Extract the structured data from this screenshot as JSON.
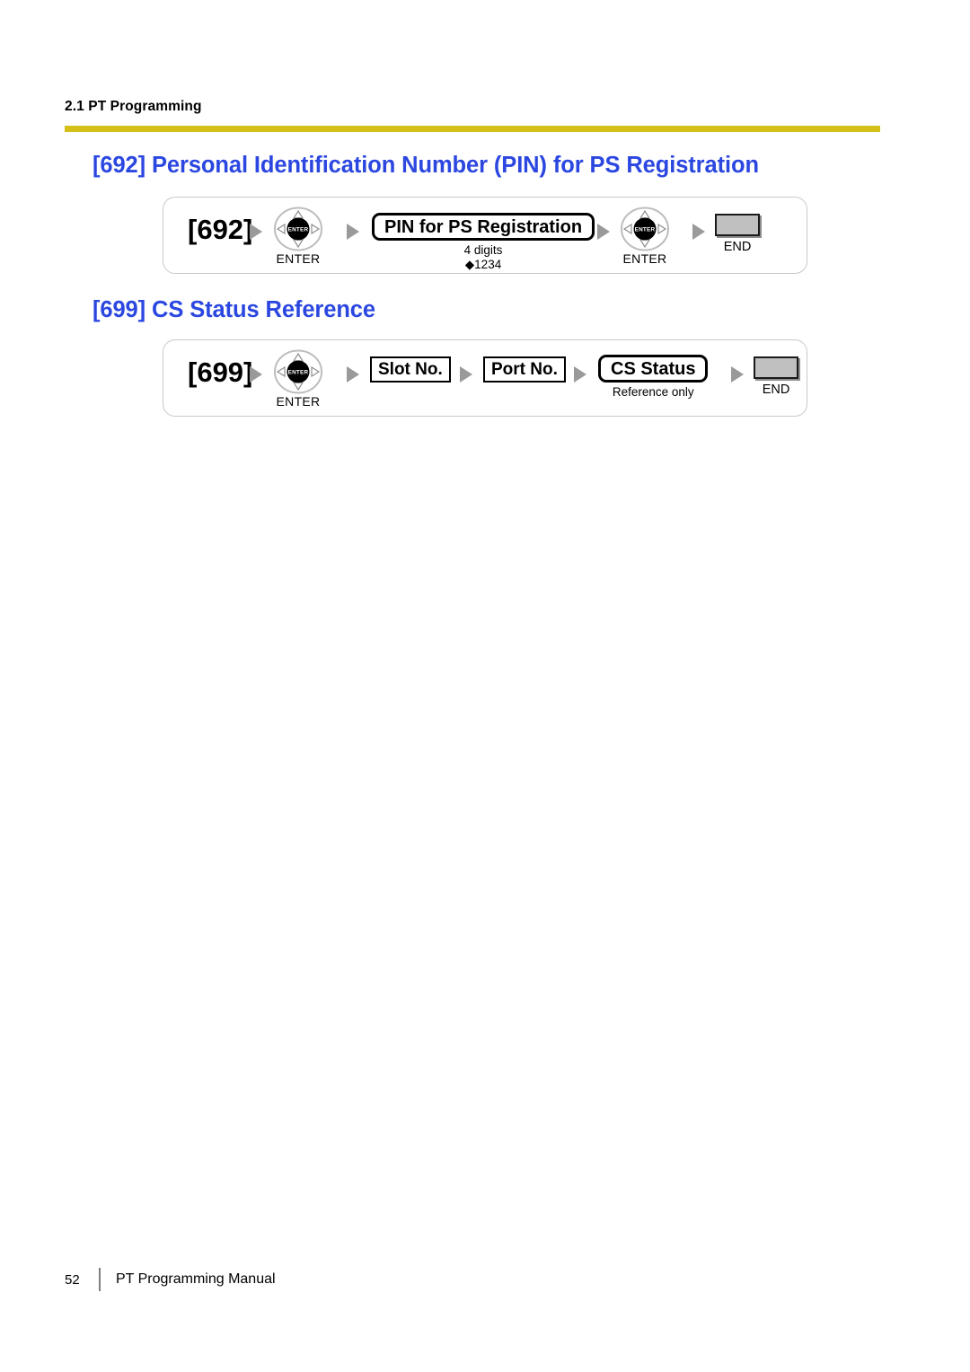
{
  "header": {
    "running_head": "2.1 PT Programming",
    "rule_color": "#d4c017"
  },
  "sections": [
    {
      "heading": "[692] Personal Identification Number (PIN) for PS Registration",
      "heading_color": "#2b47e0",
      "flow": {
        "code": "[692]",
        "enter1_label": "ENTER",
        "param_box": "PIN for PS Registration",
        "param_caption_line1": "4 digits",
        "param_caption_line2": "◆1234",
        "enter2_label": "ENTER",
        "end_label": "END",
        "nav_key_text": "ENTER"
      }
    },
    {
      "heading": "[699] CS Status Reference",
      "heading_color": "#2b47e0",
      "flow": {
        "code": "[699]",
        "enter1_label": "ENTER",
        "slot_box": "Slot No.",
        "port_box": "Port No.",
        "status_box": "CS Status",
        "status_caption": "Reference only",
        "end_label": "END",
        "nav_key_text": "ENTER"
      }
    }
  ],
  "footer": {
    "page_number": "52",
    "manual_title": "PT Programming Manual"
  }
}
